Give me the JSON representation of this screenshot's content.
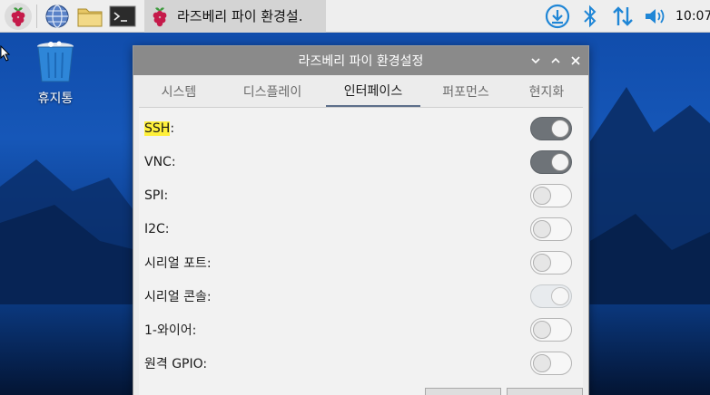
{
  "taskbar": {
    "menu_icon": "raspberry-menu-icon",
    "launchers": [
      {
        "name": "web-browser-icon"
      },
      {
        "name": "file-manager-icon"
      },
      {
        "name": "terminal-icon"
      }
    ],
    "task": {
      "label": "라즈베리 파이 환경설.",
      "icon": "raspberry-icon"
    },
    "tray": [
      "update-icon",
      "bluetooth-icon",
      "network-icon",
      "volume-icon"
    ],
    "clock": "10:07"
  },
  "desktop": {
    "trash_label": "휴지통"
  },
  "window": {
    "title": "라즈베리 파이 환경설정",
    "tabs": [
      {
        "label": "시스템",
        "active": false
      },
      {
        "label": "디스플레이",
        "active": false
      },
      {
        "label": "인터페이스",
        "active": true
      },
      {
        "label": "퍼포먼스",
        "active": false
      },
      {
        "label": "현지화",
        "active": false
      }
    ],
    "rows": [
      {
        "label_hl": "SSH",
        "label": ":",
        "state": "on"
      },
      {
        "label_hl": "",
        "label": "VNC:",
        "state": "on"
      },
      {
        "label_hl": "",
        "label": "SPI:",
        "state": "off"
      },
      {
        "label_hl": "",
        "label": "I2C:",
        "state": "off"
      },
      {
        "label_hl": "",
        "label": "시리얼 포트:",
        "state": "off"
      },
      {
        "label_hl": "",
        "label": "시리얼 콘솔:",
        "state": "disabled-on"
      },
      {
        "label_hl": "",
        "label": "1-와이어:",
        "state": "off"
      },
      {
        "label_hl": "",
        "label": "원격 GPIO:",
        "state": "off"
      }
    ]
  },
  "colors": {
    "titlebar": "#8a8a8a",
    "taskbar": "#eeeeee",
    "switch_on": "#6e7378",
    "highlight": "#fff03a",
    "raspberry": "#c51a4a"
  }
}
